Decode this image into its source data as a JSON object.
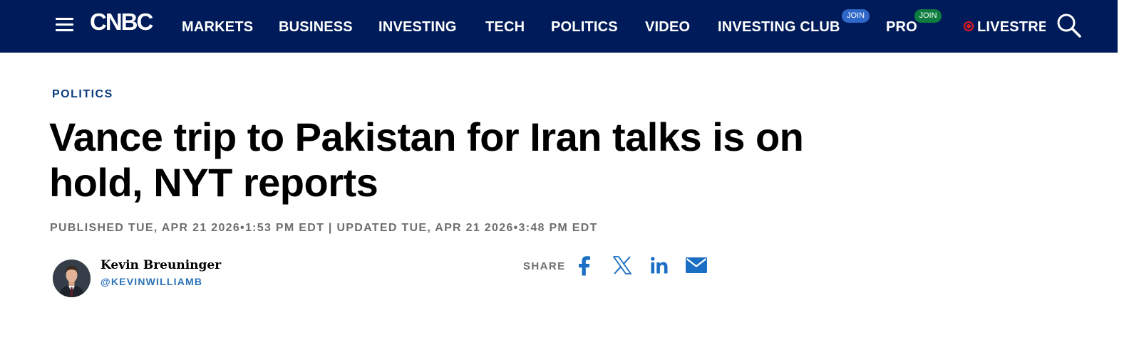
{
  "nav": {
    "logo": "CNBC",
    "items": [
      {
        "label": "MARKETS"
      },
      {
        "label": "BUSINESS"
      },
      {
        "label": "INVESTING"
      },
      {
        "label": "TECH"
      },
      {
        "label": "POLITICS"
      },
      {
        "label": "VIDEO"
      },
      {
        "label": "INVESTING CLUB",
        "badge": "JOIN"
      },
      {
        "label": "PRO",
        "badge": "JOIN"
      }
    ],
    "live_label": "LIVESTREAM",
    "icons": [
      "menu-icon",
      "search-icon",
      "live-dot-icon"
    ]
  },
  "article": {
    "section": "POLITICS",
    "headline": "Vance trip to Pakistan for Iran talks is on hold, NYT reports",
    "dateline": "PUBLISHED TUE, APR 21 2026•1:53 PM EDT | UPDATED TUE, APR 21 2026•3:48 PM EDT"
  },
  "author": {
    "name": "Kevin Breuninger",
    "handle": "@KEVINWILLIAMB"
  },
  "share": {
    "label": "SHARE",
    "icons": [
      "facebook-icon",
      "x-icon",
      "linkedin-icon",
      "email-icon"
    ]
  },
  "colors": {
    "nav_bg": "#001b5a",
    "section_blue": "#0c3d7e",
    "link_blue": "#2a72b8",
    "share_blue": "#1a6fc4",
    "live_red": "#e31b23",
    "club_badge": "#2f68c9",
    "pro_badge": "#0e7d3f",
    "meta_gray": "#6e6e6e"
  }
}
